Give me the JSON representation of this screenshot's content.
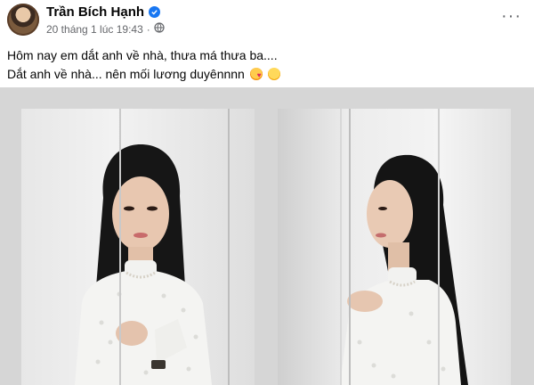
{
  "post": {
    "author": "Trần Bích Hạnh",
    "timestamp": "20 tháng 1 lúc 19:43",
    "more_label": "···",
    "caption_line1": "Hôm nay em dắt anh về nhà, thưa má thưa ba....",
    "caption_line2": "Dắt anh về nhà... nên mối lương duyênnnn",
    "caption_emojis": [
      "smiling-face-with-hearts",
      "relieved-face"
    ],
    "icons": {
      "verified": "verified-badge-icon",
      "privacy": "public-globe-icon",
      "more": "more-options-icon"
    }
  },
  "colors": {
    "verified_blue": "#1877f2",
    "meta_gray": "#65676b",
    "photo_background": "#d6d6d6"
  }
}
